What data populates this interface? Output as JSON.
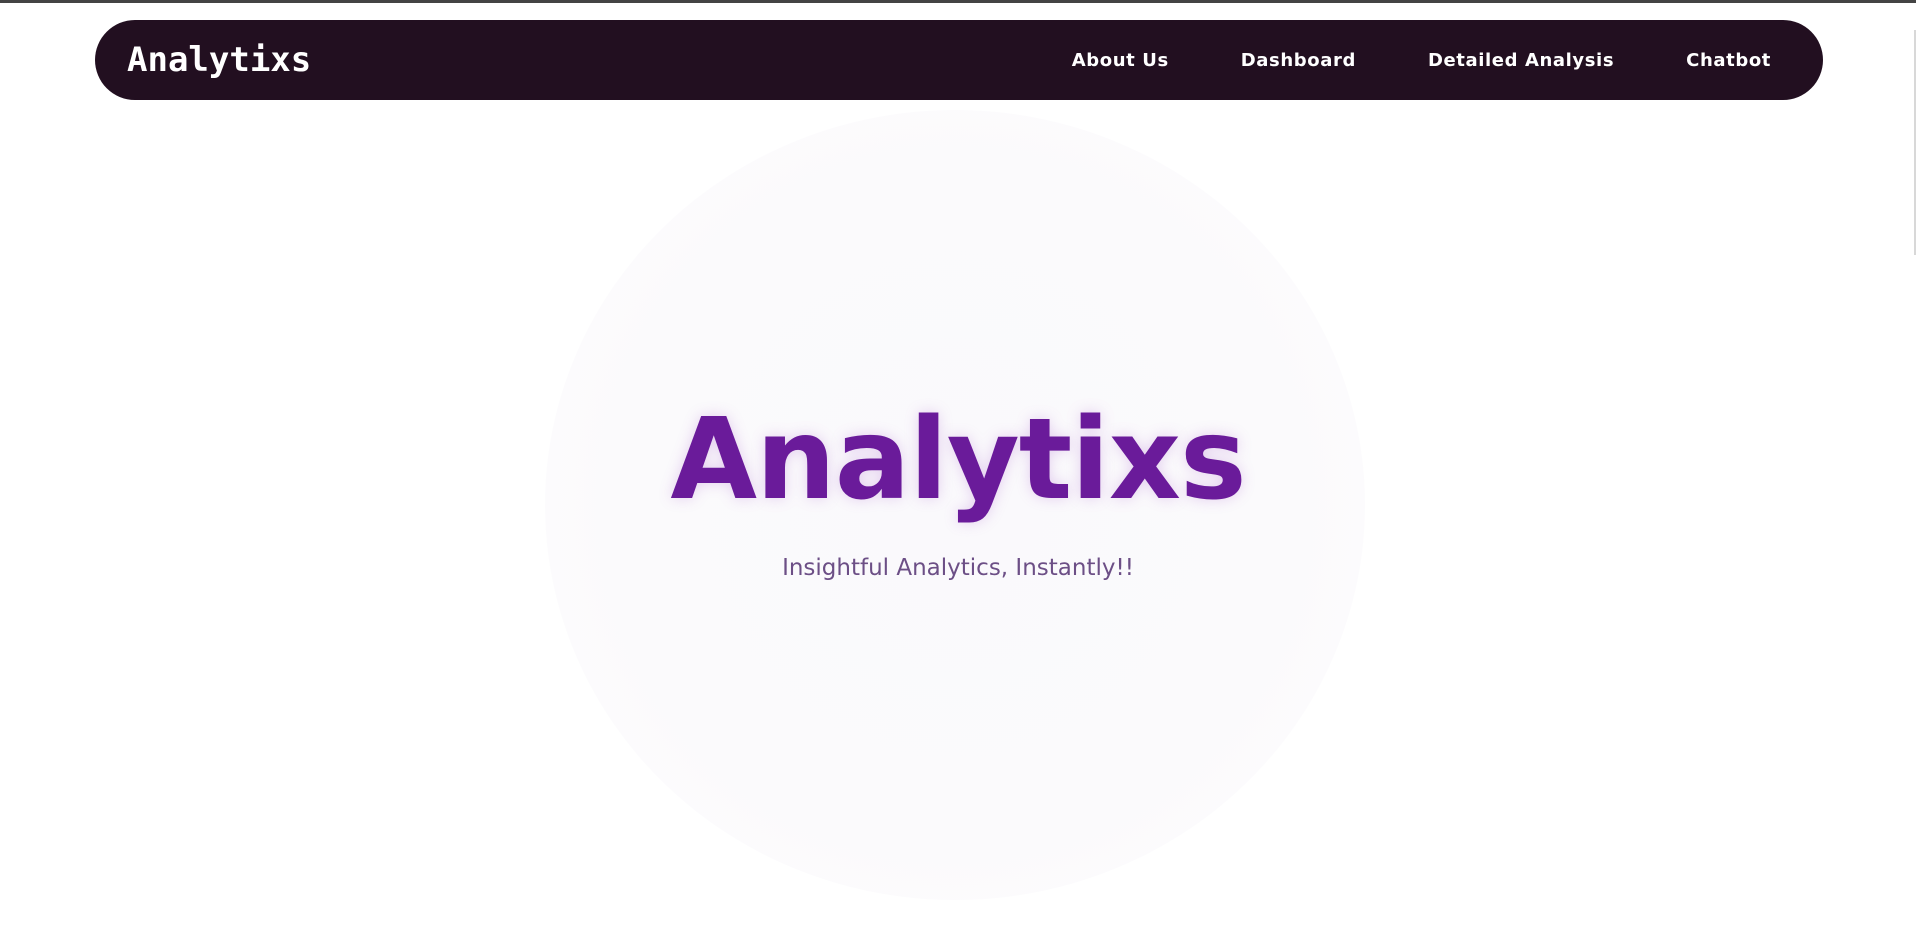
{
  "navbar": {
    "brand": "Analytixs",
    "links": [
      {
        "label": "About Us"
      },
      {
        "label": "Dashboard"
      },
      {
        "label": "Detailed Analysis"
      },
      {
        "label": "Chatbot"
      }
    ]
  },
  "hero": {
    "title": "Analytixs",
    "subtitle": "Insightful Analytics, Instantly!!"
  },
  "colors": {
    "navbar_bg": "#220f20",
    "accent": "#6a1b9a",
    "subtitle": "#6c4f86"
  }
}
